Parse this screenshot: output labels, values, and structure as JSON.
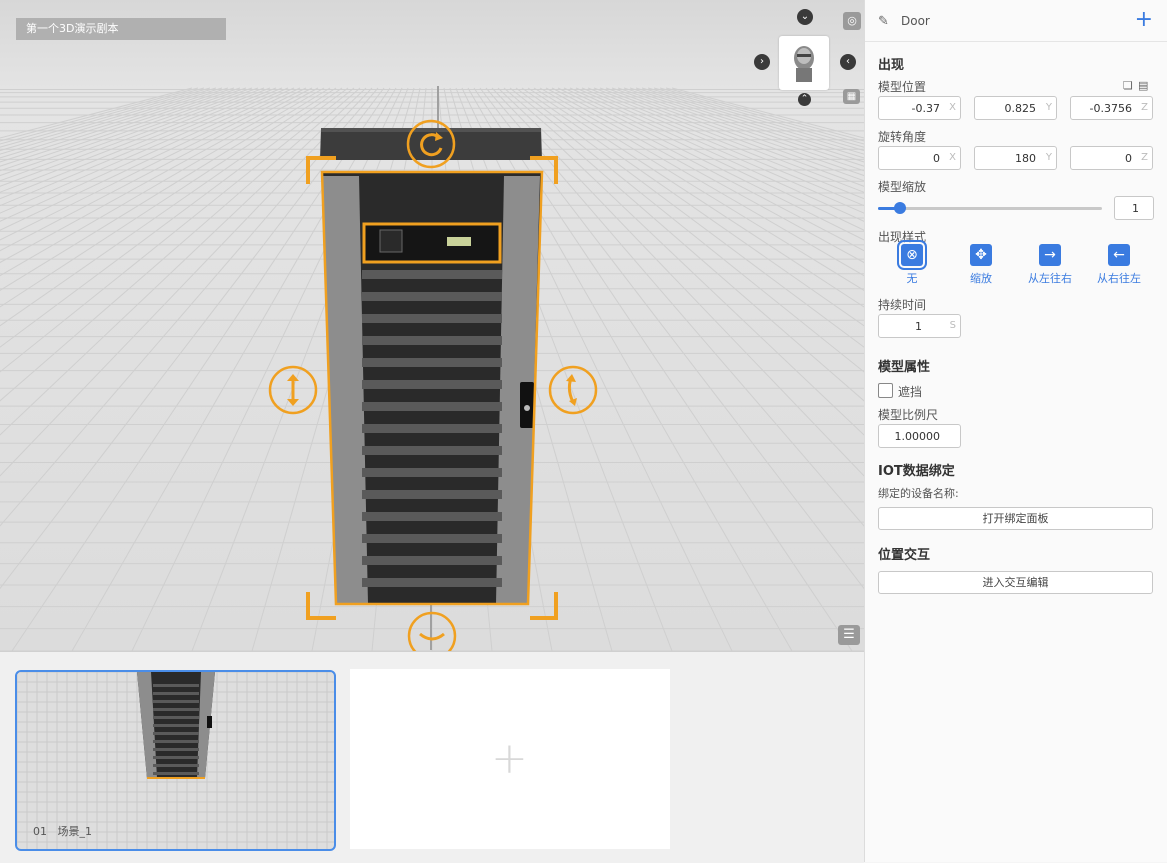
{
  "viewport": {
    "scene_title": "第一个3D演示剧本",
    "controls": {
      "collapse_icon": "chevron-down",
      "expand_icon": "chevron-up",
      "left_icon": "chevron-left",
      "right_icon": "chevron-right",
      "target_icon": "target",
      "grid_icon": "grid",
      "list_icon": "list"
    }
  },
  "panel": {
    "object_name": "Door",
    "appear": {
      "section_title": "出现",
      "position_label": "模型位置",
      "position": {
        "x": "-0.37",
        "y": "0.825",
        "z": "-0.3756"
      },
      "rotation_label": "旋转角度",
      "rotation": {
        "x": "0",
        "y": "180",
        "z": "0"
      },
      "scale_label": "模型缩放",
      "scale_value": "1",
      "scale_slider_fraction": 0.1,
      "style_label": "出现样式",
      "styles": [
        {
          "label": "无",
          "icon": "close-circle",
          "selected": true
        },
        {
          "label": "缩放",
          "icon": "move-arrows",
          "selected": false
        },
        {
          "label": "从左往右",
          "icon": "arrow-right",
          "selected": false
        },
        {
          "label": "从右往左",
          "icon": "arrow-left",
          "selected": false
        }
      ],
      "duration_label": "持续时间",
      "duration_value": "1",
      "duration_unit": "S"
    },
    "model_props": {
      "section_title": "模型属性",
      "occlusion_label": "遮挡",
      "occlusion_checked": false,
      "ratio_label": "模型比例尺",
      "ratio_value": "1.00000"
    },
    "iot": {
      "section_title": "IOT数据绑定",
      "device_label": "绑定的设备名称:",
      "open_panel_button": "打开绑定面板"
    },
    "interaction": {
      "section_title": "位置交互",
      "edit_button": "进入交互编辑"
    },
    "axis_units": {
      "x": "X",
      "y": "Y",
      "z": "Z"
    }
  },
  "strip": {
    "scenes": [
      {
        "index": "01",
        "name": "场景_1"
      }
    ]
  },
  "colors": {
    "accent": "#3a7be0",
    "gizmo": "#f0a020"
  }
}
